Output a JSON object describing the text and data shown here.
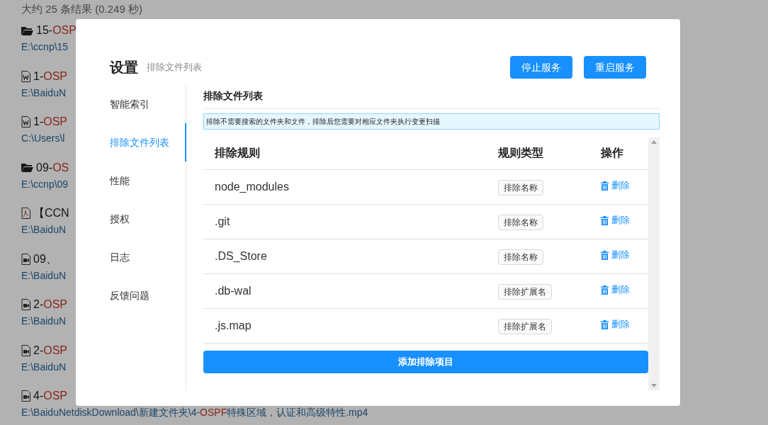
{
  "results_summary": "大约 25 条结果 (0.249 秒)",
  "results": [
    {
      "kind": "folder",
      "title": [
        {
          "text": "15-",
          "highlight": false
        },
        {
          "text": "OSP",
          "highlight": true
        }
      ],
      "path": [
        {
          "text": "E:\\ccnp\\15",
          "highlight": false
        }
      ]
    },
    {
      "kind": "word",
      "title": [
        {
          "text": "1-",
          "highlight": false
        },
        {
          "text": "OSP",
          "highlight": true
        }
      ],
      "path": [
        {
          "text": "E:\\BaiduN",
          "highlight": false
        }
      ]
    },
    {
      "kind": "word",
      "title": [
        {
          "text": "1-",
          "highlight": false
        },
        {
          "text": "OSP",
          "highlight": true
        }
      ],
      "path": [
        {
          "text": "C:\\Users\\l",
          "highlight": false
        }
      ]
    },
    {
      "kind": "folder",
      "title": [
        {
          "text": "09-",
          "highlight": false
        },
        {
          "text": "OS",
          "highlight": true
        }
      ],
      "path": [
        {
          "text": "E:\\ccnp\\09",
          "highlight": false
        }
      ]
    },
    {
      "kind": "pdf",
      "title": [
        {
          "text": "【CCN",
          "highlight": false
        }
      ],
      "path": [
        {
          "text": "E:\\BaiduN",
          "highlight": false
        }
      ]
    },
    {
      "kind": "video",
      "title": [
        {
          "text": "09、",
          "highlight": false
        }
      ],
      "path": [
        {
          "text": "E:\\BaiduN",
          "highlight": false
        }
      ]
    },
    {
      "kind": "video",
      "title": [
        {
          "text": "2-",
          "highlight": false
        },
        {
          "text": "OSP",
          "highlight": true
        }
      ],
      "path": [
        {
          "text": "E:\\BaiduN",
          "highlight": false
        }
      ]
    },
    {
      "kind": "video",
      "title": [
        {
          "text": "2-",
          "highlight": false
        },
        {
          "text": "OSP",
          "highlight": true
        }
      ],
      "path": [
        {
          "text": "E:\\BaiduN",
          "highlight": false
        }
      ]
    },
    {
      "kind": "video",
      "title": [
        {
          "text": "4-",
          "highlight": false
        },
        {
          "text": "OSP",
          "highlight": true
        }
      ],
      "path": [
        {
          "text": "E:\\BaiduNetdiskDownload\\新建文件夹\\4-",
          "highlight": false
        },
        {
          "text": "OSPF",
          "highlight": true
        },
        {
          "text": "特殊区域，认证和高级特性.mp4",
          "highlight": false
        }
      ]
    }
  ],
  "dialog": {
    "title": "设置",
    "subtitle": "排除文件列表",
    "buttons": [
      "停止服务",
      "重启服务"
    ],
    "sidebar": {
      "items": [
        {
          "label": "智能索引",
          "selected": false
        },
        {
          "label": "排除文件列表",
          "selected": true
        },
        {
          "label": "性能",
          "selected": false
        },
        {
          "label": "授权",
          "selected": false
        },
        {
          "label": "日志",
          "selected": false
        },
        {
          "label": "反馈问题",
          "selected": false
        }
      ]
    },
    "section_title": "排除文件列表",
    "notice": "排除不需要搜索的文件夹和文件，排除后您需要对相应文件夹执行变更扫描",
    "table": {
      "columns": [
        "排除规则",
        "规则类型",
        "操作"
      ],
      "rows": [
        {
          "rule": "node_modules",
          "type": "排除名称",
          "action": "删除"
        },
        {
          "rule": ".git",
          "type": "排除名称",
          "action": "删除"
        },
        {
          "rule": ".DS_Store",
          "type": "排除名称",
          "action": "删除"
        },
        {
          "rule": ".db-wal",
          "type": "排除扩展名",
          "action": "删除"
        },
        {
          "rule": ".js.map",
          "type": "排除扩展名",
          "action": "删除"
        }
      ]
    },
    "add_button": "添加排除项目"
  }
}
